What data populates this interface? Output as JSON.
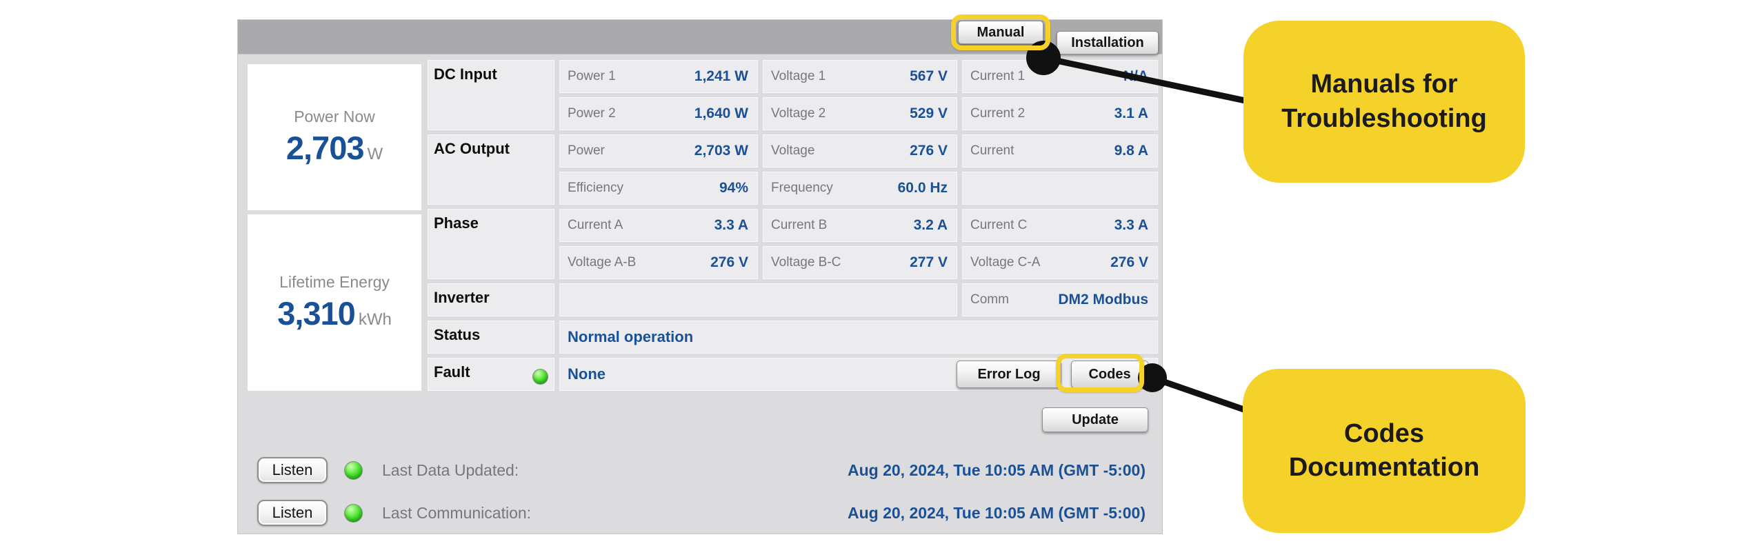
{
  "colors": {
    "accent_blue": "#1a5196",
    "panel_bg": "#dcdcde",
    "band_bg": "#aaaaad",
    "cell_bg": "#ececee",
    "highlight_yellow": "#f5d22a",
    "led_green": "#55e636"
  },
  "header": {
    "manual": "Manual",
    "installation": "Installation"
  },
  "summary": {
    "power_now": {
      "label": "Power Now",
      "value": "2,703",
      "unit": "W"
    },
    "lifetime_energy": {
      "label": "Lifetime Energy",
      "value": "3,310",
      "unit": "kWh"
    }
  },
  "sections": {
    "dc": "DC Input",
    "ac": "AC Output",
    "phase": "Phase",
    "inverter": "Inverter",
    "status": "Status",
    "fault": "Fault"
  },
  "metrics": {
    "power1": {
      "label": "Power 1",
      "value": "1,241 W"
    },
    "voltage1": {
      "label": "Voltage 1",
      "value": "567 V"
    },
    "current1": {
      "label": "Current 1",
      "value": "N/A"
    },
    "power2": {
      "label": "Power 2",
      "value": "1,640 W"
    },
    "voltage2": {
      "label": "Voltage 2",
      "value": "529 V"
    },
    "current2": {
      "label": "Current 2",
      "value": "3.1 A"
    },
    "ac_power": {
      "label": "Power",
      "value": "2,703 W"
    },
    "ac_voltage": {
      "label": "Voltage",
      "value": "276 V"
    },
    "ac_current": {
      "label": "Current",
      "value": "9.8 A"
    },
    "efficiency": {
      "label": "Efficiency",
      "value": "94%"
    },
    "frequency": {
      "label": "Frequency",
      "value": "60.0 Hz"
    },
    "current_a": {
      "label": "Current A",
      "value": "3.3 A"
    },
    "current_b": {
      "label": "Current B",
      "value": "3.2 A"
    },
    "current_c": {
      "label": "Current C",
      "value": "3.3 A"
    },
    "voltage_ab": {
      "label": "Voltage A-B",
      "value": "276 V"
    },
    "voltage_bc": {
      "label": "Voltage B-C",
      "value": "277 V"
    },
    "voltage_ca": {
      "label": "Voltage C-A",
      "value": "276 V"
    },
    "comm": {
      "label": "Comm",
      "value": "DM2 Modbus"
    }
  },
  "status": {
    "operation": "Normal operation",
    "fault": "None"
  },
  "buttons": {
    "error_log": "Error Log",
    "codes": "Codes",
    "update": "Update",
    "listen": "Listen"
  },
  "footer": {
    "last_data_label": "Last Data Updated:",
    "last_comm_label": "Last Communication:",
    "last_data_value": "Aug 20, 2024, Tue 10:05 AM (GMT -5:00)",
    "last_comm_value": "Aug 20, 2024, Tue 10:05 AM (GMT -5:00)"
  },
  "annotations": {
    "manual_note": "Manuals for Troubleshooting",
    "codes_note": "Codes Documentation"
  }
}
